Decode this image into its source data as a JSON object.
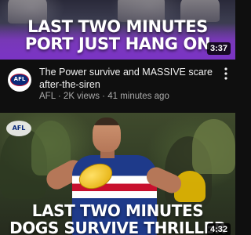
{
  "feed": {
    "videos": [
      {
        "thumbnail_text": [
          "LAST TWO MINUTES",
          "PORT JUST HANG ON"
        ],
        "duration": "3:37",
        "title": "The Power survive and MASSIVE scare after-the-siren",
        "channel": "AFL",
        "views": "2K views",
        "age": "41 minutes ago",
        "meta_separator": "·",
        "channel_logo_text": "AFL",
        "menu_icon": "more-vertical-icon",
        "thumbnail_accent": "#7a34c4"
      },
      {
        "thumbnail_text": [
          "LAST TWO MINUTES",
          "DOGS SURVIVE THRILLER"
        ],
        "duration": "4:32",
        "watermark_text": "AFL",
        "thumbnail_accent": "#1e3a8a"
      }
    ]
  }
}
